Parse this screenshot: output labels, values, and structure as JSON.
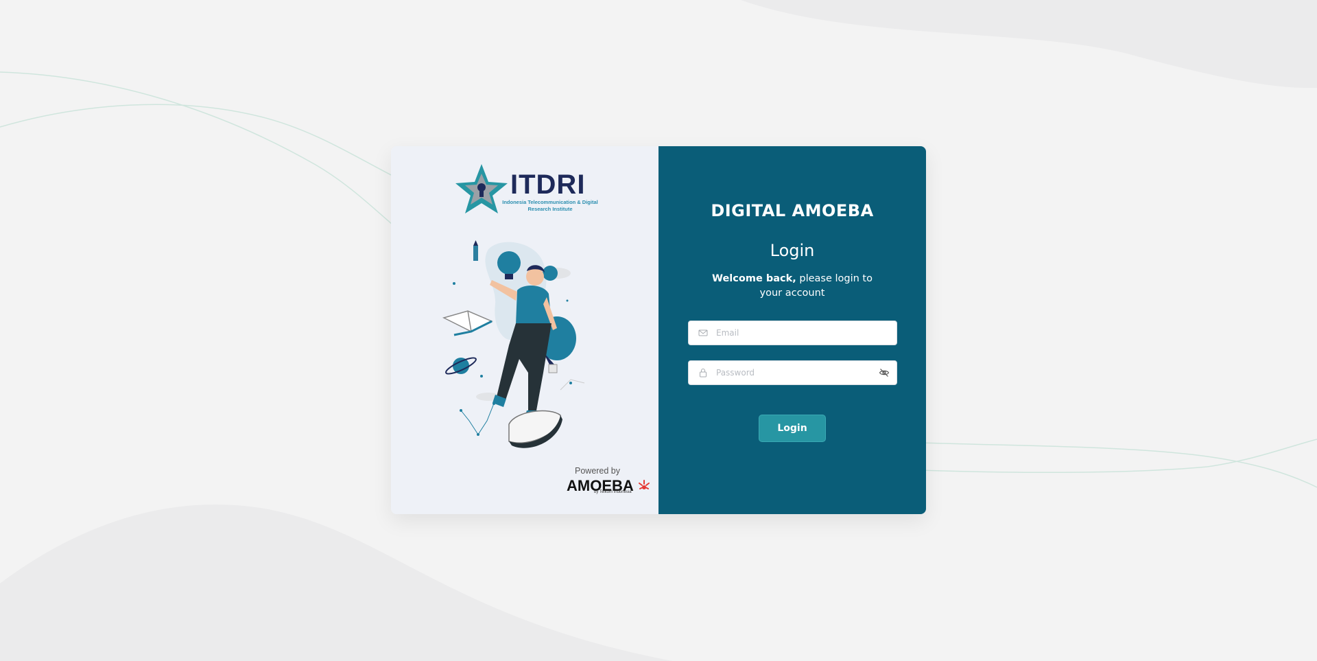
{
  "brand": {
    "logo_name": "ITDRI",
    "logo_subtitle": "Indonesia Telecommunication & Digital Research Institute",
    "powered_by_label": "Powered by",
    "powered_by_name": "AMOEBA",
    "powered_by_tagline": "by Telkom Indonesia"
  },
  "login": {
    "app_title": "DIGITAL AMOEBA",
    "heading": "Login",
    "welcome_bold": "Welcome back,",
    "welcome_rest": " please login to your account",
    "email_placeholder": "Email",
    "email_value": "",
    "password_placeholder": "Password",
    "password_value": "",
    "submit_label": "Login"
  },
  "colors": {
    "page_background": "#f3f3f3",
    "left_panel": "#eef1f7",
    "right_panel": "#0a5d78",
    "button": "#2796a3",
    "accent_teal": "#2c8fb0",
    "logo_navy": "#1e2a5a"
  },
  "icons": {
    "email_field": "mail-icon",
    "password_field": "lock-icon",
    "password_toggle": "eye-off-icon",
    "logo_mark": "star-keyhole-icon"
  }
}
